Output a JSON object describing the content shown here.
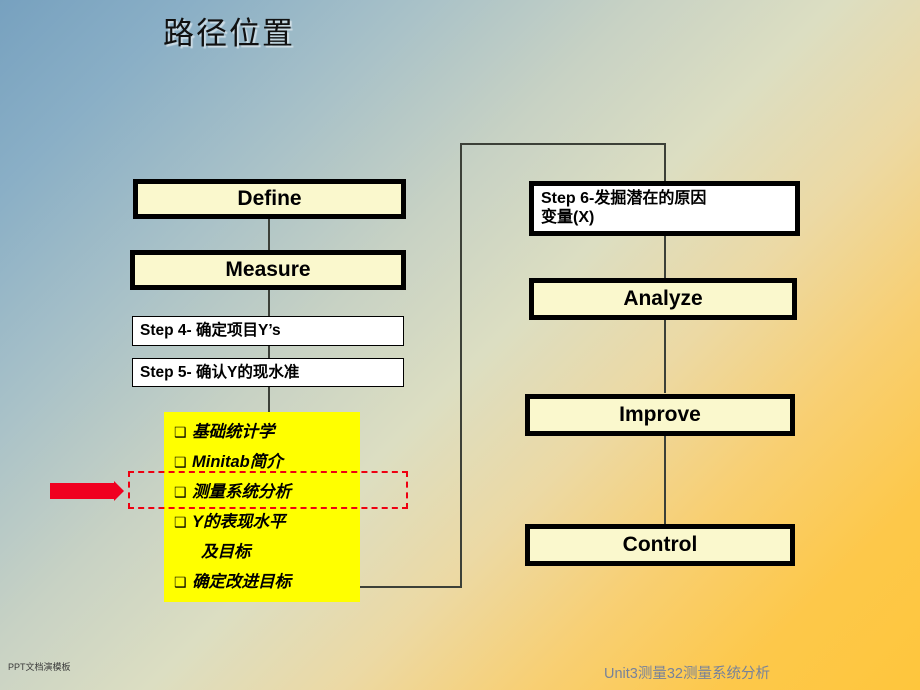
{
  "slide": {
    "title": "路径位置",
    "background": {
      "from_color": "#77a1bf",
      "mid_color": "#dcdec2",
      "to_color": "#fec63c"
    }
  },
  "left_column": {
    "define_box": {
      "label": "Define",
      "fill": "#FAF8CD",
      "border": "#000000"
    },
    "measure_box": {
      "label": "Measure",
      "fill": "#FAF8CD",
      "border": "#000000"
    },
    "step4_box": {
      "label": "Step 4- 确定项目Y’s",
      "fill": "#FFFFFF",
      "border": "#000000"
    },
    "step5_box": {
      "label": "Step 5- 确认Y的现水准",
      "fill": "#FFFFFF",
      "border": "#000000"
    },
    "yellow_panel": {
      "fill": "#FFFF00",
      "bullet_glyph": "❑",
      "items": [
        {
          "text": "基础统计学",
          "continuation": false
        },
        {
          "text": "Minitab简介",
          "continuation": false
        },
        {
          "text": "测量系统分析",
          "continuation": false
        },
        {
          "text": "Y的表现水平",
          "continuation": false
        },
        {
          "text": "及目标",
          "continuation": true
        },
        {
          "text": "确定改进目标",
          "continuation": false
        }
      ]
    },
    "highlight": {
      "target": "测量系统分析",
      "color": "#EE0011",
      "style": "dashed"
    },
    "pointer": {
      "color": "#F00020",
      "direction": "right"
    }
  },
  "right_column": {
    "step6_box": {
      "label": "Step 6-发掘潜在的原因\n           变量(X)",
      "fill": "#FFFFFF",
      "border": "#000000"
    },
    "analyze_box": {
      "label": "Analyze",
      "fill": "#FAF8CD",
      "border": "#000000"
    },
    "improve_box": {
      "label": "Improve",
      "fill": "#FAF8CD",
      "border": "#000000"
    },
    "control_box": {
      "label": "Control",
      "fill": "#FAF8CD",
      "border": "#000000"
    }
  },
  "footer": {
    "left_text": "PPT文档演模板",
    "right_text": "Unit3测量32测量系统分析",
    "right_color": "#77829a"
  }
}
